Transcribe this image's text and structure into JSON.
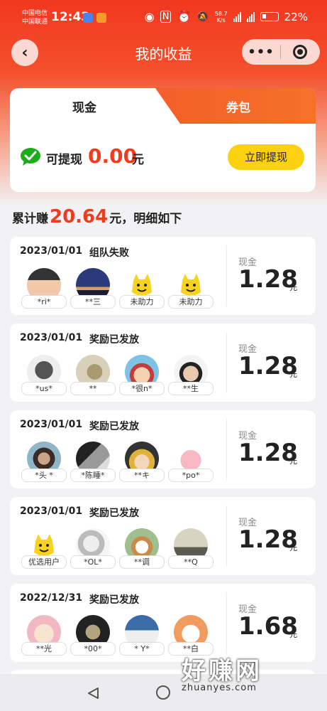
{
  "status_bar": {
    "carrier1": "中国电信",
    "carrier2": "中国联通",
    "time": "12:43",
    "speed": "58.7",
    "speed_unit": "K/s",
    "net1": "4G",
    "net2": "4G",
    "battery": "22%"
  },
  "header": {
    "title": "我的收益",
    "more": "•••"
  },
  "wallet": {
    "tab_cash": "现金",
    "tab_coupon": "券包",
    "withdraw_label": "可提现",
    "withdraw_amount": "0.00",
    "withdraw_unit": "元",
    "withdraw_button": "立即提现"
  },
  "summary": {
    "prefix": "累计赚",
    "amount": "20.64",
    "suffix": "元，明细如下"
  },
  "records": [
    {
      "date": "2023/01/01",
      "status": "组队失败",
      "currency": "现金",
      "amount": "1.28",
      "unit": "元",
      "helpers": [
        "*ri*",
        "**三",
        "未助力",
        "未助力"
      ]
    },
    {
      "date": "2023/01/01",
      "status": "奖励已发放",
      "currency": "现金",
      "amount": "1.28",
      "unit": "元",
      "helpers": [
        "*us*",
        "**",
        "*很n*",
        "**生"
      ]
    },
    {
      "date": "2023/01/01",
      "status": "奖励已发放",
      "currency": "现金",
      "amount": "1.28",
      "unit": "元",
      "helpers": [
        "*头 *",
        "*陈睡*",
        "**キ",
        "*po*"
      ]
    },
    {
      "date": "2023/01/01",
      "status": "奖励已发放",
      "currency": "现金",
      "amount": "1.28",
      "unit": "元",
      "helpers": [
        "优选用户",
        "*OL*",
        "**调",
        "**Q"
      ]
    },
    {
      "date": "2022/12/31",
      "status": "奖励已发放",
      "currency": "现金",
      "amount": "1.68",
      "unit": "元",
      "helpers": [
        "**光",
        "*00*",
        "* Y*",
        "**白"
      ]
    }
  ],
  "watermark": {
    "big": "好赚网",
    "small": "zhuanyes.com"
  },
  "colors": {
    "header_red": "#f2371f",
    "accent_red": "#f23a1d",
    "button_yellow": "#fdd010",
    "wechat_green": "#1aad19"
  }
}
